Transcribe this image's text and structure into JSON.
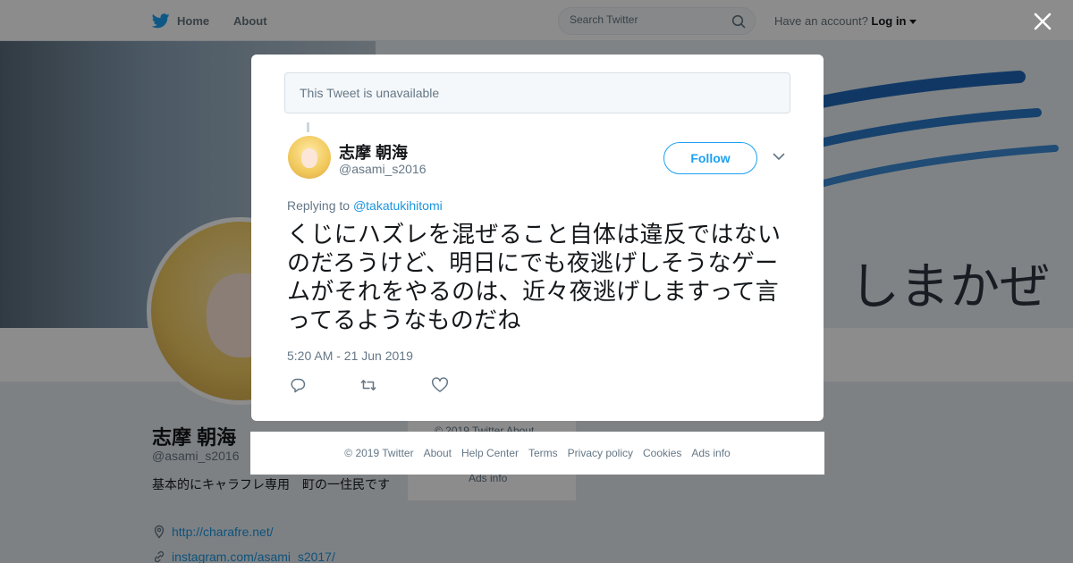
{
  "nav": {
    "home_label": "Home",
    "about_label": "About",
    "search_placeholder": "Search Twitter",
    "account_prompt": "Have an account?",
    "login_label": "Log in"
  },
  "colors": {
    "twitter_blue": "#1da1f2",
    "link_blue": "#1b95e0",
    "secondary_text": "#657786",
    "primary_text": "#14171a"
  },
  "banner": {
    "brand_text": "しまかぜ"
  },
  "profile": {
    "name": "志摩 朝海",
    "handle": "@asami_s2016",
    "bio": "基本的にキャラフレ専用　町の一住民です",
    "links": [
      {
        "icon": "location-icon",
        "text": "http://charafre.net/"
      },
      {
        "icon": "link-icon",
        "text": "instagram.com/asami_s2017/"
      }
    ]
  },
  "side_footer": {
    "line1": "© 2019 Twitter   About",
    "line2": "Ads info"
  },
  "modal": {
    "unavailable_text": "This Tweet is unavailable",
    "tweet": {
      "author_name": "志摩 朝海",
      "author_handle": "@asami_s2016",
      "follow_label": "Follow",
      "replying_prefix": "Replying to",
      "replying_mention": "@takatukihitomi",
      "text": "くじにハズレを混ぜること自体は違反ではないのだろうけど、明日にでも夜逃げしそうなゲームがそれをやるのは、近々夜逃げしますって言ってるようなものだね",
      "timestamp": "5:20 AM - 21 Jun 2019",
      "actions": [
        "reply-icon",
        "retweet-icon",
        "like-icon"
      ]
    }
  },
  "footer": {
    "links": [
      "© 2019 Twitter",
      "About",
      "Help Center",
      "Terms",
      "Privacy policy",
      "Cookies",
      "Ads info"
    ]
  }
}
